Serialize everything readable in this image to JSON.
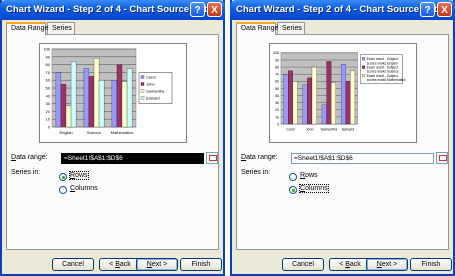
{
  "window": {
    "title": "Chart Wizard - Step 2 of 4 - Chart Source Data",
    "help_glyph": "?",
    "close_glyph": "X"
  },
  "tabs": [
    "Data Range",
    "Series"
  ],
  "form": {
    "range_label_first": "D",
    "range_label_rest": "ata range:",
    "series_in_label": "Series in:",
    "rows_first": "R",
    "rows_rest": "ows",
    "columns_first": "C",
    "columns_rest": "olumns"
  },
  "buttons": {
    "cancel": "Cancel",
    "back_first": "B",
    "back_prefix": "< ",
    "back_rest": "ack",
    "next_first": "N",
    "next_rest": "ext >",
    "finish": "Finish"
  },
  "colors": {
    "titlebar": "#0a5be0",
    "plot_bg": "#c0c0c0",
    "series": [
      "#9999ff",
      "#993366",
      "#ffffcc",
      "#ccffff"
    ]
  },
  "left": {
    "data_range": "=Sheet1!$A$1:$D$6",
    "series_in": "rows",
    "chart_data": {
      "type": "bar",
      "categories": [
        "English",
        "Science",
        "Mathematics"
      ],
      "series": [
        {
          "name": "Carol",
          "values": [
            70,
            75,
            60
          ]
        },
        {
          "name": "John",
          "values": [
            55,
            65,
            80
          ]
        },
        {
          "name": "Samantha",
          "values": [
            27,
            88,
            58
          ]
        },
        {
          "name": "Edward",
          "values": [
            84,
            60,
            75
          ]
        }
      ],
      "ylim": [
        0,
        100
      ],
      "yticks": [
        0,
        10,
        20,
        30,
        40,
        50,
        60,
        70,
        80,
        90,
        100
      ],
      "grid": true,
      "legend": "right"
    }
  },
  "right": {
    "data_range": "=Sheet1!$A$1:$D$6",
    "series_in": "columns",
    "chart_data": {
      "type": "bar",
      "categories": [
        "Carol",
        "John",
        "Samantha",
        "Edward"
      ],
      "series": [
        {
          "name": "Exam result - Subject scores marks English",
          "values": [
            70,
            55,
            27,
            84
          ]
        },
        {
          "name": "Exam result - Subject scores marks Science",
          "values": [
            75,
            65,
            88,
            60
          ]
        },
        {
          "name": "Exam result - Subject scores marks Mathematics",
          "values": [
            60,
            80,
            58,
            75
          ]
        }
      ],
      "ylim": [
        0,
        100
      ],
      "yticks": [
        0,
        10,
        20,
        30,
        40,
        50,
        60,
        70,
        80,
        90,
        100
      ],
      "grid": true,
      "legend": "right"
    }
  }
}
